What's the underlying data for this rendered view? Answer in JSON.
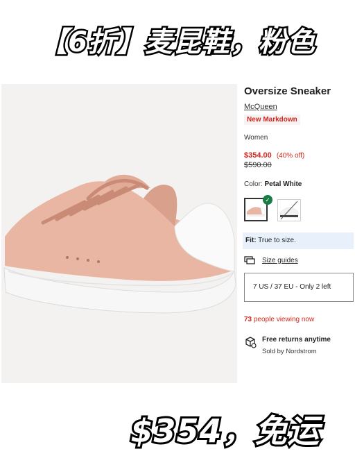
{
  "overlay": {
    "top_banner": "【6折】麦昆鞋，粉色",
    "bottom_banner": "$354，免运"
  },
  "product": {
    "title": "Oversize Sneaker",
    "brand": "McQueen",
    "badge": "New Markdown",
    "category": "Women",
    "price": "$354.00",
    "discount": "(40% off)",
    "original_price": "$590.00",
    "color_label": "Color:",
    "color_value": "Petal White",
    "fit_label": "Fit:",
    "fit_value": "True to size.",
    "size_guides": "Size guides",
    "selected_size": "7 US / 37 EU - Only 2 left",
    "viewing_count": "73",
    "viewing_text": "people viewing now",
    "returns_title": "Free returns anytime",
    "sold_by": "Sold by Nordstrom"
  },
  "colors": {
    "accent_red": "#d3271d",
    "check_green": "#1a7c45",
    "fit_bg": "#e8f1fb",
    "shoe_pink": "#e8b6a2"
  },
  "icons": [
    "check-icon",
    "ruler-icon",
    "box-return-icon"
  ]
}
